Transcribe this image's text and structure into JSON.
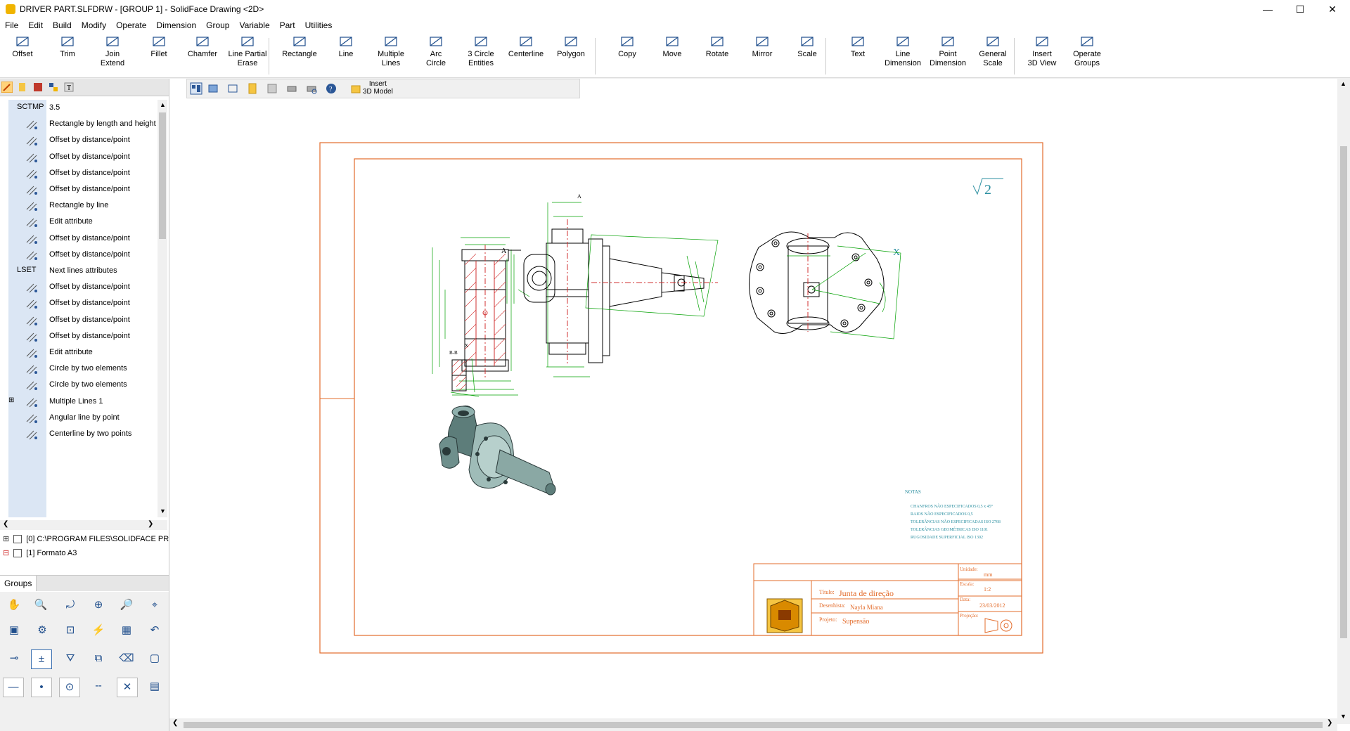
{
  "window": {
    "title": "DRIVER PART.SLFDRW - [GROUP 1] - SolidFace Drawing <2D>",
    "minimize": "—",
    "maximize": "☐",
    "close": "✕"
  },
  "menu": [
    "File",
    "Edit",
    "Build",
    "Modify",
    "Operate",
    "Dimension",
    "Group",
    "Variable",
    "Part",
    "Utilities"
  ],
  "ribbon": [
    {
      "label": "Offset",
      "icon": "offset-icon"
    },
    {
      "label": "Trim",
      "icon": "trim-icon"
    },
    {
      "label": "Join\nExtend",
      "icon": "join-extend-icon"
    },
    {
      "label": "Fillet",
      "icon": "fillet-icon"
    },
    {
      "label": "Chamfer",
      "icon": "chamfer-icon"
    },
    {
      "label": "Line Partial\nErase",
      "icon": "line-partial-erase-icon"
    },
    {
      "label": "Rectangle",
      "icon": "rectangle-icon"
    },
    {
      "label": "Line",
      "icon": "line-icon"
    },
    {
      "label": "Multiple\nLines",
      "icon": "multiple-lines-icon"
    },
    {
      "label": "Arc\nCircle",
      "icon": "arc-circle-icon"
    },
    {
      "label": "3 Circle\nEntities",
      "icon": "three-circle-icon"
    },
    {
      "label": "Centerline",
      "icon": "centerline-icon"
    },
    {
      "label": "Polygon",
      "icon": "polygon-icon"
    },
    {
      "label": "Copy",
      "icon": "copy-icon"
    },
    {
      "label": "Move",
      "icon": "move-icon"
    },
    {
      "label": "Rotate",
      "icon": "rotate-icon"
    },
    {
      "label": "Mirror",
      "icon": "mirror-icon"
    },
    {
      "label": "Scale",
      "icon": "scale-icon"
    },
    {
      "label": "Text",
      "icon": "text-icon"
    },
    {
      "label": "Line\nDimension",
      "icon": "line-dimension-icon"
    },
    {
      "label": "Point\nDimension",
      "icon": "point-dimension-icon"
    },
    {
      "label": "General\nScale",
      "icon": "general-scale-icon"
    },
    {
      "label": "Insert\n3D View",
      "icon": "insert-3d-view-icon"
    },
    {
      "label": "Operate\nGroups",
      "icon": "operate-groups-icon"
    }
  ],
  "commands": [
    {
      "code": "SCTMP",
      "label": "3.5",
      "icon": ""
    },
    {
      "code": "",
      "label": "Rectangle by length and height",
      "icon": "rectangle-icon"
    },
    {
      "code": "",
      "label": "Offset by distance/point",
      "icon": "offset-icon"
    },
    {
      "code": "",
      "label": "Offset by distance/point",
      "icon": "offset-icon"
    },
    {
      "code": "",
      "label": "Offset by distance/point",
      "icon": "offset-icon"
    },
    {
      "code": "",
      "label": "Offset by distance/point",
      "icon": "offset-icon"
    },
    {
      "code": "",
      "label": "Rectangle by line",
      "icon": "rectangle-line-icon"
    },
    {
      "code": "",
      "label": "Edit attribute",
      "icon": "edit-attribute-icon"
    },
    {
      "code": "",
      "label": "Offset by distance/point",
      "icon": "offset-icon"
    },
    {
      "code": "",
      "label": "Offset by distance/point",
      "icon": "offset-icon"
    },
    {
      "code": "LSET",
      "label": "Next lines attributes",
      "icon": ""
    },
    {
      "code": "",
      "label": "Offset by distance/point",
      "icon": "offset-icon"
    },
    {
      "code": "",
      "label": "Offset by distance/point",
      "icon": "offset-icon"
    },
    {
      "code": "",
      "label": "Offset by distance/point",
      "icon": "offset-icon"
    },
    {
      "code": "",
      "label": "Offset by distance/point",
      "icon": "offset-icon"
    },
    {
      "code": "",
      "label": "Edit attribute",
      "icon": "edit-attribute-icon"
    },
    {
      "code": "",
      "label": "Circle by two elements",
      "icon": "circle-icon"
    },
    {
      "code": "",
      "label": "Circle by two elements",
      "icon": "circle-icon"
    },
    {
      "code": "",
      "label": "Multiple Lines 1",
      "icon": "multiple-lines-icon"
    },
    {
      "code": "",
      "label": "Angular line by point",
      "icon": "line-icon"
    },
    {
      "code": "",
      "label": "Centerline by two points",
      "icon": "centerline-icon"
    }
  ],
  "tree": [
    {
      "label": "[0] C:\\PROGRAM FILES\\SOLIDFACE PR",
      "expander": "⊞"
    },
    {
      "label": "[1] Formato A3",
      "expander": "⊟"
    }
  ],
  "groups_tab": "Groups",
  "canvas_toolbar": {
    "insert_label": "Insert\n3D Model"
  },
  "drawing": {
    "roughness": "2",
    "view_mark": "X",
    "section_label": "B-B",
    "section_x": "X",
    "arrow_label": "A",
    "notes_title": "NOTAS",
    "notes": [
      "CHANFROS NÃO ESPECIFICADOS 0,5 x 45°",
      "RAIOS NÃO ESPECIFICADOS 0,5",
      "TOLERÂNCIAS NÃO ESPECIFICADAS ISO 2768",
      "TOLERÂNCIAS GEOMÉTRICAS ISO 1101",
      "RUGOSIDADE SUPERFICIAL ISO 1302"
    ],
    "titleblock": {
      "titulo_label": "Título:",
      "titulo_value": "Junta de direção",
      "desenhista_label": "Desenhista:",
      "desenhista_value": "Nayla Miana",
      "projeto_label": "Projeto:",
      "projeto_value": "Supensão",
      "unidade_label": "Unidade:",
      "unidade_value": "mm",
      "escala_label": "Escala:",
      "escala_value": "1:2",
      "data_label": "Data:",
      "data_value": "23/03/2012",
      "projecao_label": "Projeção:"
    }
  },
  "colors": {
    "border": "#e36c2b",
    "dim": "#00a000",
    "hatch": "#d23030",
    "text_orange": "#e36c2b",
    "notes_blue": "#2b8fa0"
  }
}
